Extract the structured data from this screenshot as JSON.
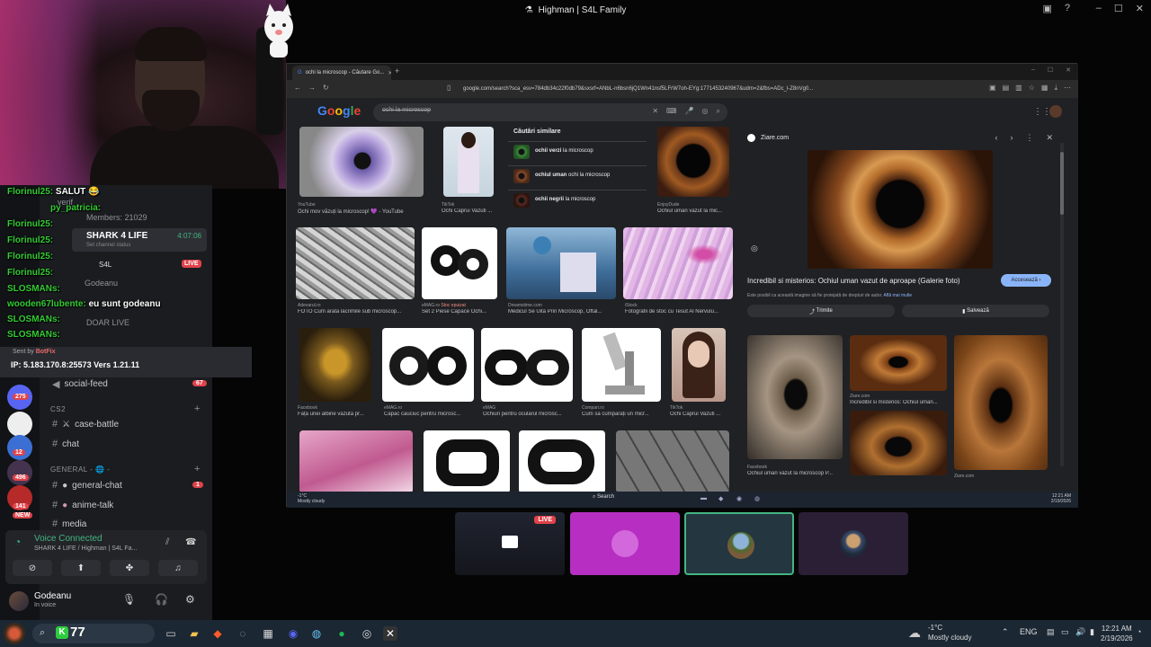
{
  "window": {
    "title": "Highman | S4L Family"
  },
  "chat": {
    "lines": [
      {
        "who": "Florinul25:",
        "msg": "SALUT 😂"
      },
      {
        "who": "py_patricia:",
        "msg": ""
      },
      {
        "who": "Florinul25:",
        "msg": ""
      },
      {
        "who": "Florinul25:",
        "msg": ""
      },
      {
        "who": "Florinul25:",
        "msg": ""
      },
      {
        "who": "Florinul25:",
        "msg": ""
      },
      {
        "who": "SLOSMANs:",
        "msg": ""
      },
      {
        "who": "wooden67lubente:",
        "msg": "eu sunt godeanu"
      },
      {
        "who": "SLOSMANs:",
        "msg": ""
      },
      {
        "who": "SLOSMANs:",
        "msg": ""
      }
    ]
  },
  "overlay": {
    "verif": "verif",
    "members": "Members: 21029",
    "shark": "SHARK 4 LIFE",
    "shark_time": "4:07:06",
    "channel_status": "Set channel status",
    "s4l": "S4L",
    "live": "LIVE",
    "godeanu": "Godeanu",
    "doar_live": "DOAR LIVE"
  },
  "botmsg": {
    "sent_by": "Sent by",
    "bot": "BotFix",
    "ip": "IP: 5.183.170.8:25573 Vers 1.21.11"
  },
  "channels": {
    "social_feed": "social-feed",
    "social_feed_count": "67",
    "cat_cs2": "CS2",
    "case_battle": "case-battle",
    "chat": "chat",
    "cat_general": "GENERAL - 🌐 -",
    "general_chat": "general-chat",
    "general_chat_count": "1",
    "anime_talk": "anime-talk",
    "media": "media"
  },
  "servers": [
    {
      "badge": "275"
    },
    {
      "badge": ""
    },
    {
      "badge": "12"
    },
    {
      "badge": "496"
    },
    {
      "badge": "141"
    },
    {
      "badge": "NEW"
    }
  ],
  "voice": {
    "connected": "Voice Connected",
    "status": "SHARK 4 LIFE / Highman | S4L Fa..."
  },
  "user": {
    "name": "Godeanu",
    "status": "In voice"
  },
  "browser": {
    "tab_title": "ochi la microscop - Căutare Go...",
    "url": "google.com/search?sca_esv=784db34c22f0db79&sxsrf=ANbL-n6bsn6jQ1Wn41nsf5LFrW7oh-EYg:1771453240967&udm=2&fbs=ADc_l-Z8nVg0...",
    "query": "ochi la microscop",
    "similar_heading": "Căutări similare",
    "similar": [
      {
        "bold": "ochii verzi",
        "rest": " la microscop"
      },
      {
        "bold": "ochiul uman",
        "rest": " ochi la microscop"
      },
      {
        "bold": "ochii negrii",
        "rest": " la microscop"
      }
    ],
    "results": [
      {
        "src": "YouTube",
        "cap": "Ochi mov văzuți la microscop! 💜 - YouTube"
      },
      {
        "src": "TikTok",
        "cap": "Ochi Caprui Vazuti ..."
      },
      {
        "src": "EnjoyDude",
        "cap": "Ochiul uman vazut la mic..."
      },
      {
        "src": "Adevarul.ro",
        "cap": "FOTO Cum arată lacrimile sub microscop..."
      },
      {
        "src": "eMAG.ro",
        "badge": "Stoc epuizat",
        "cap": "Set 2 Piese Capace Ochi..."
      },
      {
        "src": "Dreamstime.com",
        "cap": "Medicul Se Uită Prin Microscop, Oftal..."
      },
      {
        "src": "iStock",
        "cap": "Fotografii de stoc cu Tesut Al Nervulu..."
      },
      {
        "src": "Facebook",
        "cap": "Fața unei albine văzută pr..."
      },
      {
        "src": "eMAG.ro",
        "cap": "Capac cauciuc pentru microsc..."
      },
      {
        "src": "eMAG",
        "cap": "Ochiuri pentru ocularul microsc..."
      },
      {
        "src": "Compari.ro",
        "cap": "Cum să cumpărați un micr..."
      },
      {
        "src": "TikTok",
        "cap": "Ochi Caprui Vazuti ..."
      }
    ],
    "preview": {
      "site": "Ziare.com",
      "title": "Incredibil si misterios: Ochiul uman vazut de aproape (Galerie foto)",
      "visit": "Accesează ›",
      "note": "Este posibil ca această imagine să fie protejată de drepturi de autor.",
      "note_link": "Află mai multe",
      "share": "Trimite",
      "save": "Salvează",
      "related": [
        {
          "src": "Ziare.com",
          "cap": "Incredibil si misterios: Ochiul uman..."
        },
        {
          "src": "Facebook",
          "cap": "Ochiul uman văzut la microscop P..."
        },
        {
          "src": "Ziare.com",
          "cap": ""
        }
      ]
    },
    "inner_taskbar": {
      "temp": "-1°C",
      "weather": "Mostly cloudy",
      "search": "Search",
      "time": "12:21 AM",
      "date": "2/19/2026"
    }
  },
  "streams": [
    {
      "live": "LIVE"
    },
    {
      "live": ""
    },
    {
      "live": ""
    },
    {
      "live": ""
    }
  ],
  "taskbar": {
    "counter": "77",
    "temp": "-1°C",
    "weather": "Mostly cloudy",
    "lang": "ENG",
    "time": "12:21 AM",
    "date": "2/19/2026"
  }
}
